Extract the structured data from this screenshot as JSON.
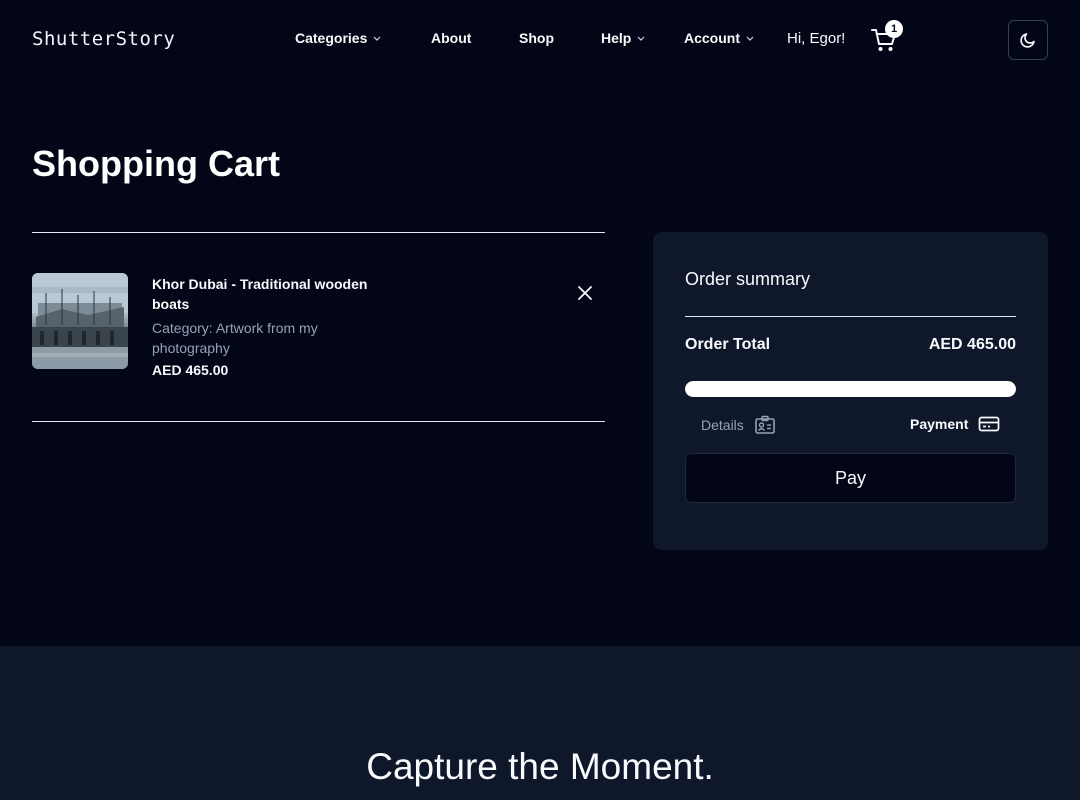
{
  "brand": {
    "logo": "ShutterStory"
  },
  "nav": {
    "items": [
      {
        "label": "Categories",
        "dropdown": true
      },
      {
        "label": "About",
        "dropdown": false
      },
      {
        "label": "Shop",
        "dropdown": false
      },
      {
        "label": "Help",
        "dropdown": true
      },
      {
        "label": "Account",
        "dropdown": true
      }
    ],
    "greeting": "Hi, Egor!",
    "cart_count": "1",
    "theme_icon": "moon-icon"
  },
  "page": {
    "title": "Shopping Cart"
  },
  "cart": {
    "items": [
      {
        "name": "Khor Dubai - Traditional wooden boats",
        "category": "Category: Artwork from my photography",
        "price": "AED 465.00"
      }
    ]
  },
  "summary": {
    "title": "Order summary",
    "total_label": "Order Total",
    "total_value": "AED 465.00",
    "progress_percent": 100,
    "steps": [
      {
        "label": "Details",
        "icon": "id-card-icon",
        "active": false
      },
      {
        "label": "Payment",
        "icon": "credit-card-icon",
        "active": true
      }
    ],
    "pay_label": "Pay"
  },
  "footer": {
    "tagline": "Capture the Moment."
  },
  "colors": {
    "background": "#020617",
    "panel": "#0f172a",
    "muted": "#94a3b8",
    "accent": "#ffffff"
  }
}
